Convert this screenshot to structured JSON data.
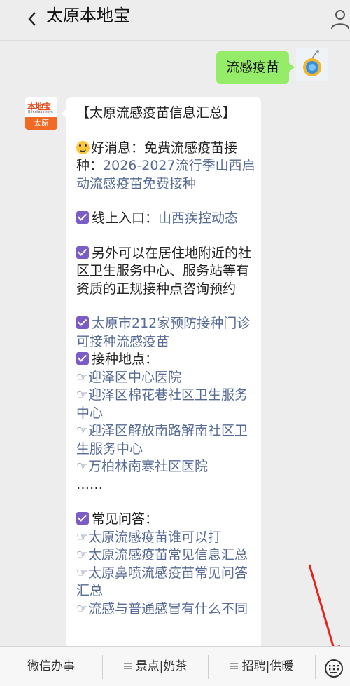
{
  "header": {
    "title": "太原本地宝",
    "back_icon": "chevron-left-icon",
    "profile_icon": "person-icon"
  },
  "chat": {
    "user_message": "流感疫苗",
    "bot_avatar": {
      "brand": "本地宝",
      "url": "Bendibao.com",
      "city": "太原"
    },
    "bot_message": {
      "heading": "【太原流感疫苗信息汇总】",
      "good_news_prefix": "好消息：免费流感疫苗接",
      "good_news_line2_prefix": "种：",
      "good_news_link_1": "2026-2027流行季山西启",
      "good_news_link_2": "动流感疫苗免费接种",
      "online_entry_label": "线上入口：",
      "online_entry_link": "山西疾控动态",
      "community_line_1": "另外可以在居住地附近的社",
      "community_line_2": "区卫生服务中心、服务站等有",
      "community_line_3": "资质的正规接种点咨询预约",
      "clinics_link_1": "太原市212家预防接种门诊",
      "clinics_link_2": "可接种流感疫苗",
      "locations_label": "接种地点：",
      "locations": [
        "☞迎泽区中心医院",
        "☞迎泽区棉花巷社区卫生服务",
        "中心",
        "☞迎泽区解放南路解南社区卫",
        "生服务中心",
        "☞万柏林南寒社区医院"
      ],
      "ellipsis": "……",
      "faq_label": "常见问答：",
      "faq": [
        "☞太原流感疫苗谁可以打",
        "☞太原流感疫苗常见信息汇总",
        "☞太原鼻喷流感疫苗常见问答",
        "汇总",
        "☞流感与普通感冒有什么不同"
      ]
    }
  },
  "menu": {
    "items": [
      "微信办事",
      "景点|奶茶",
      "招聘|供暖"
    ],
    "keyboard_icon": "keyboard-icon"
  },
  "colors": {
    "link": "#576b95",
    "user_bubble": "#95ec69",
    "check": "#7b5cc7",
    "annotation_arrow": "#e8231b"
  }
}
